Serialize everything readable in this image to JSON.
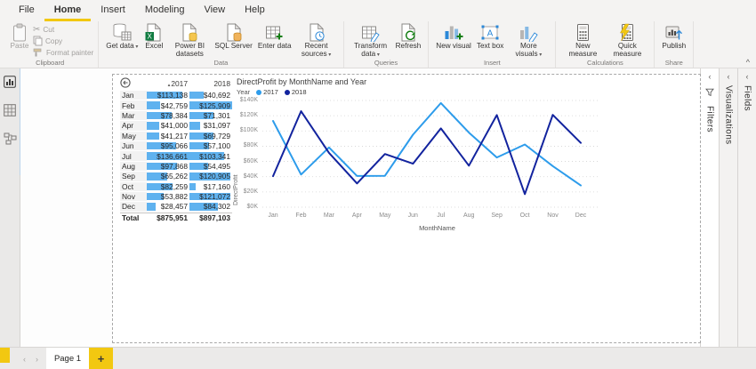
{
  "accent_color": "#F2C811",
  "tabs": [
    {
      "label": "File",
      "active": false
    },
    {
      "label": "Home",
      "active": true
    },
    {
      "label": "Insert",
      "active": false
    },
    {
      "label": "Modeling",
      "active": false
    },
    {
      "label": "View",
      "active": false
    },
    {
      "label": "Help",
      "active": false
    }
  ],
  "ribbon": {
    "groups": [
      {
        "label": "Clipboard",
        "disabled": true,
        "big": [
          {
            "label": "Paste",
            "icon": "clipboard-icon"
          }
        ],
        "small": [
          {
            "label": "Cut",
            "icon": "scissors-icon"
          },
          {
            "label": "Copy",
            "icon": "copy-icon"
          },
          {
            "label": "Format painter",
            "icon": "format-painter-icon"
          }
        ]
      },
      {
        "label": "Data",
        "big": [
          {
            "label": "Get data",
            "icon": "database-icon",
            "dropdown": true
          },
          {
            "label": "Excel",
            "icon": "excel-icon"
          },
          {
            "label": "Power BI datasets",
            "icon": "powerbi-datasets-icon"
          },
          {
            "label": "SQL Server",
            "icon": "sql-server-icon"
          },
          {
            "label": "Enter data",
            "icon": "enter-data-icon"
          },
          {
            "label": "Recent sources",
            "icon": "recent-sources-icon",
            "dropdown": true
          }
        ]
      },
      {
        "label": "Queries",
        "big": [
          {
            "label": "Transform data",
            "icon": "transform-data-icon",
            "dropdown": true
          },
          {
            "label": "Refresh",
            "icon": "refresh-icon"
          }
        ]
      },
      {
        "label": "Insert",
        "big": [
          {
            "label": "New visual",
            "icon": "new-visual-icon"
          },
          {
            "label": "Text box",
            "icon": "text-box-icon"
          },
          {
            "label": "More visuals",
            "icon": "more-visuals-icon",
            "dropdown": true
          }
        ]
      },
      {
        "label": "Calculations",
        "big": [
          {
            "label": "New measure",
            "icon": "new-measure-icon"
          },
          {
            "label": "Quick measure",
            "icon": "quick-measure-icon"
          }
        ]
      },
      {
        "label": "Share",
        "big": [
          {
            "label": "Publish",
            "icon": "publish-icon"
          }
        ]
      }
    ]
  },
  "view_sidebar": [
    {
      "icon": "report-view-icon",
      "active": true
    },
    {
      "icon": "data-view-icon",
      "active": false
    },
    {
      "icon": "model-view-icon",
      "active": false
    }
  ],
  "table": {
    "bar_color": "#5FB2EF",
    "columns": [
      "2017",
      "2018"
    ],
    "rows": [
      {
        "month": "Jan",
        "v2017": 113138,
        "v2018": 40692,
        "t2017": "$113,138",
        "t2018": "$40,692"
      },
      {
        "month": "Feb",
        "v2017": 42759,
        "v2018": 125909,
        "t2017": "$42,759",
        "t2018": "$125,909"
      },
      {
        "month": "Mar",
        "v2017": 78384,
        "v2018": 71301,
        "t2017": "$78,384",
        "t2018": "$71,301"
      },
      {
        "month": "Apr",
        "v2017": 41000,
        "v2018": 31097,
        "t2017": "$41,000",
        "t2018": "$31,097"
      },
      {
        "month": "May",
        "v2017": 41217,
        "v2018": 69729,
        "t2017": "$41,217",
        "t2018": "$69,729"
      },
      {
        "month": "Jun",
        "v2017": 95066,
        "v2018": 57100,
        "t2017": "$95,066",
        "t2018": "$57,100"
      },
      {
        "month": "Jul",
        "v2017": 136661,
        "v2018": 103341,
        "t2017": "$136,661",
        "t2018": "$103,341"
      },
      {
        "month": "Aug",
        "v2017": 97868,
        "v2018": 54495,
        "t2017": "$97,868",
        "t2018": "$54,495"
      },
      {
        "month": "Sep",
        "v2017": 65262,
        "v2018": 120905,
        "t2017": "$65,262",
        "t2018": "$120,905"
      },
      {
        "month": "Oct",
        "v2017": 82259,
        "v2018": 17160,
        "t2017": "$82,259",
        "t2018": "$17,160"
      },
      {
        "month": "Nov",
        "v2017": 53882,
        "v2018": 121072,
        "t2017": "$53,882",
        "t2018": "$121,072"
      },
      {
        "month": "Dec",
        "v2017": 28457,
        "v2018": 84302,
        "t2017": "$28,457",
        "t2018": "$84,302"
      }
    ],
    "total": {
      "label": "Total",
      "t2017": "$875,951",
      "t2018": "$897,103"
    }
  },
  "chart_data": {
    "type": "line",
    "title": "DirectProfit by MonthName and Year",
    "xlabel": "MonthName",
    "ylabel": "DirectProfit",
    "legend_title": "Year",
    "legend_position": "top-left",
    "grid": true,
    "categories": [
      "Jan",
      "Feb",
      "Mar",
      "Apr",
      "May",
      "Jun",
      "Jul",
      "Aug",
      "Sep",
      "Oct",
      "Nov",
      "Dec"
    ],
    "series": [
      {
        "name": "2017",
        "color": "#2D9CEB",
        "values": [
          113138,
          42759,
          78384,
          41000,
          41217,
          95066,
          136661,
          97868,
          65262,
          82259,
          53882,
          28457
        ]
      },
      {
        "name": "2018",
        "color": "#12239E",
        "values": [
          40692,
          125909,
          71301,
          31097,
          69729,
          57100,
          103341,
          54495,
          120905,
          17160,
          121072,
          84302
        ]
      }
    ],
    "ylim": [
      0,
      140000
    ],
    "yticks": [
      "$0K",
      "$20K",
      "$40K",
      "$60K",
      "$80K",
      "$100K",
      "$120K",
      "$140K"
    ]
  },
  "panels": [
    {
      "label": "Filters",
      "chevron": "‹",
      "icon": "funnel-icon"
    },
    {
      "label": "Visualizations",
      "chevron": "‹"
    },
    {
      "label": "Fields",
      "chevron": "‹"
    }
  ],
  "pagebar": {
    "prev": "‹",
    "next": "›",
    "page_label": "Page 1",
    "add_label": "+"
  },
  "ribbon_collapse": "^"
}
